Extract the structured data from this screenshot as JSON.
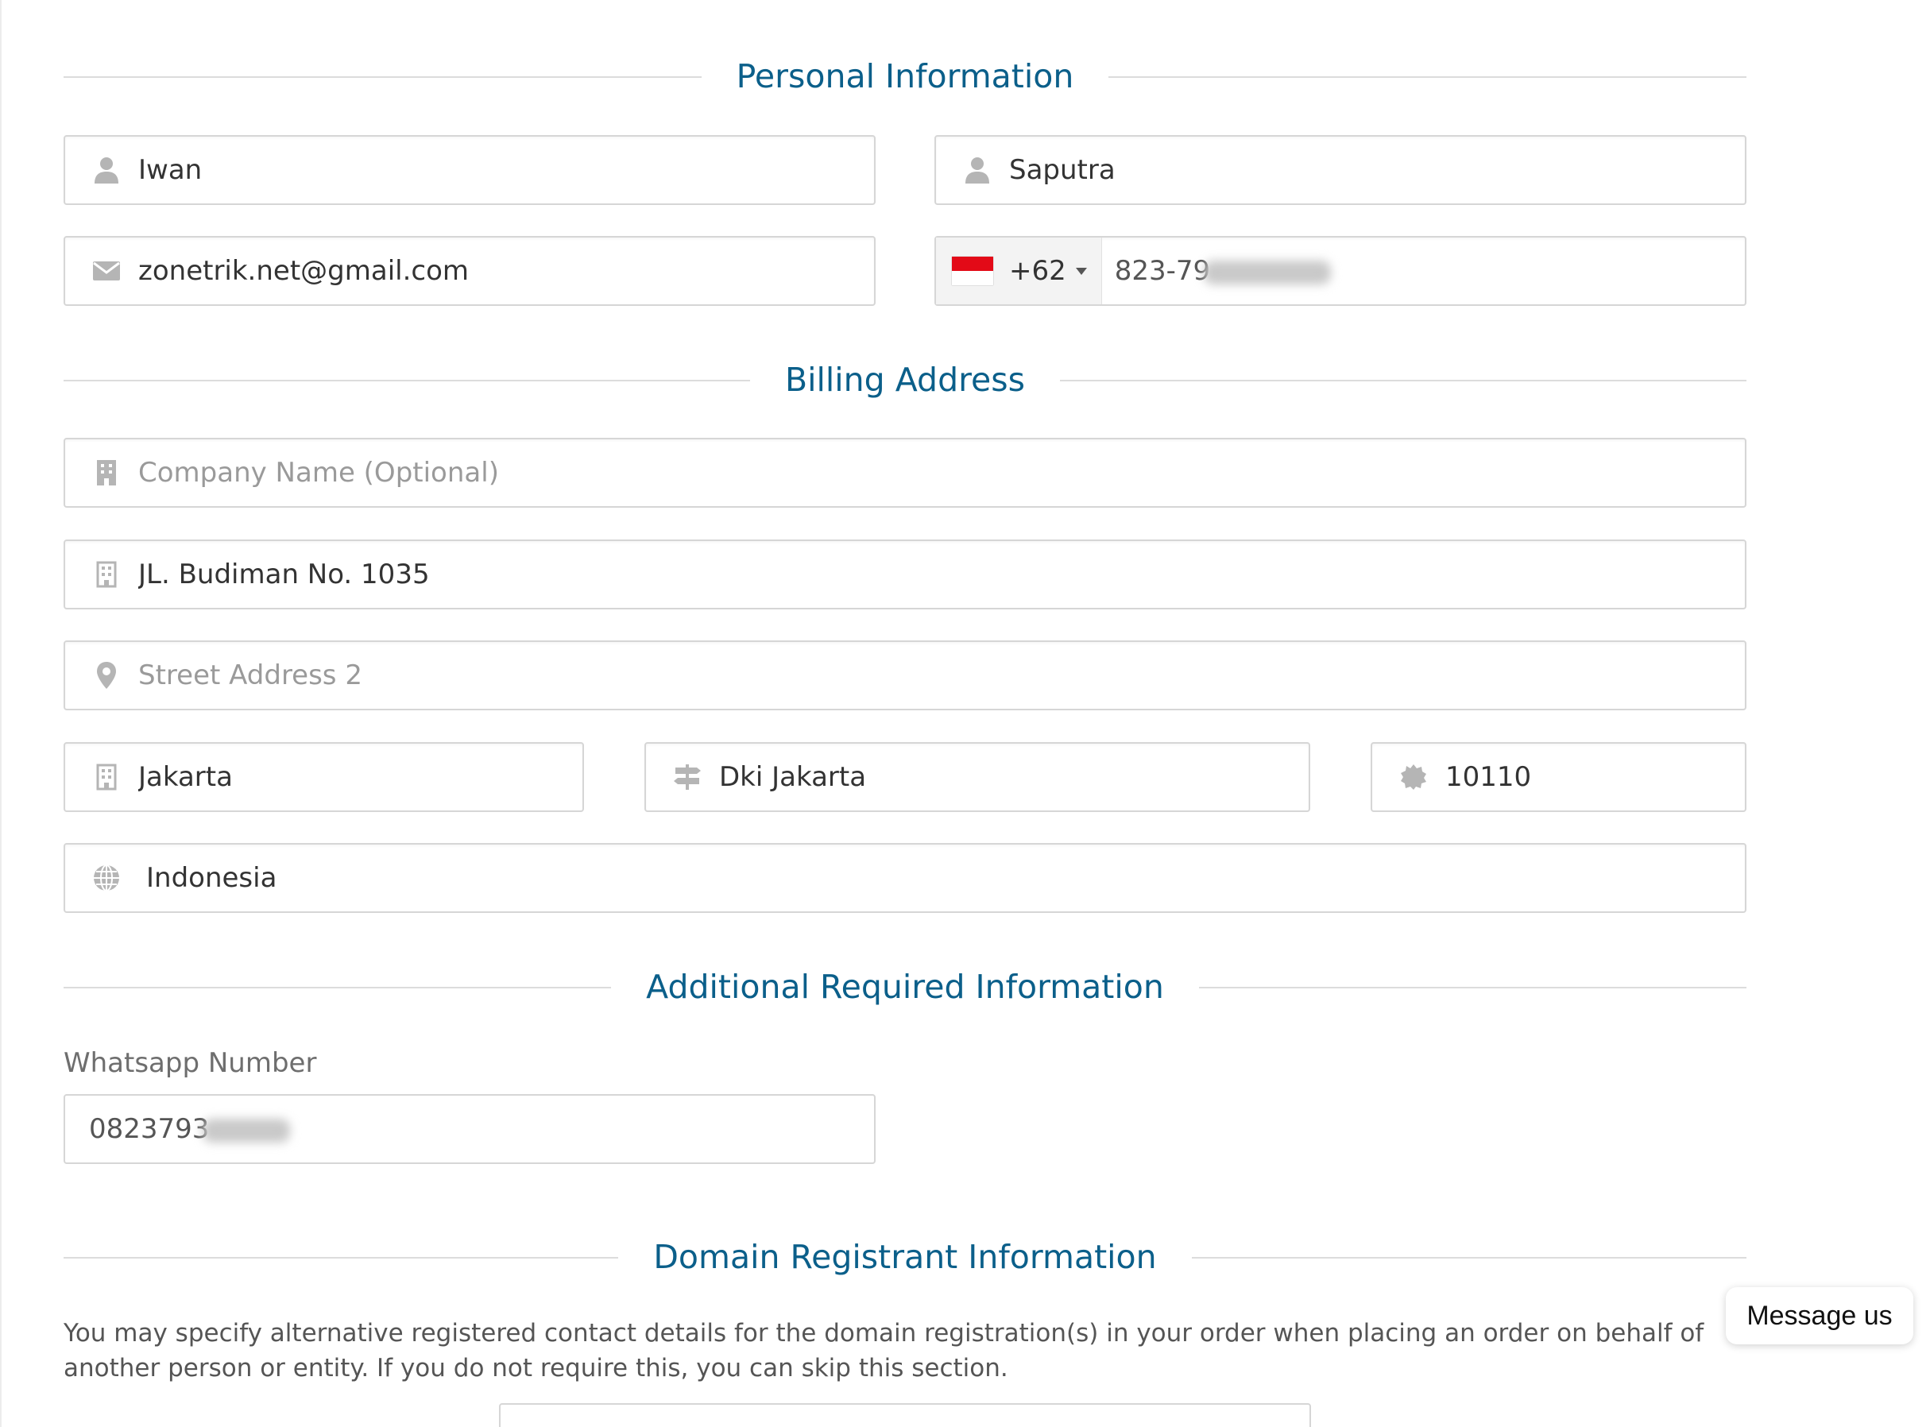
{
  "sections": {
    "personal": "Personal Information",
    "billing": "Billing Address",
    "additional": "Additional Required Information",
    "domain": "Domain Registrant Information"
  },
  "personal": {
    "first_name": "Iwan",
    "last_name": "Saputra",
    "email": "zonetrik.net@gmail.com",
    "phone_dial_code": "+62",
    "phone_number_visible": "823-79"
  },
  "billing": {
    "company_placeholder": "Company Name (Optional)",
    "address1": "JL. Budiman No. 1035",
    "address2_placeholder": "Street Address 2",
    "city": "Jakarta",
    "state": "Dki Jakarta",
    "postcode": "10110",
    "country": "Indonesia"
  },
  "additional": {
    "whatsapp_label": "Whatsapp Number",
    "whatsapp_visible": "0823793"
  },
  "domain": {
    "description": "You may specify alternative registered contact details for the domain registration(s) in your order when placing an order on behalf of another person or entity. If you do not require this, you can skip this section."
  },
  "chat": {
    "label": "Message us"
  },
  "colors": {
    "heading": "#0b5f8a",
    "icon": "#b5b5b5",
    "flag_red": "#e30a17"
  },
  "icons": [
    "user-icon",
    "envelope-icon",
    "building-icon",
    "map-marker-icon",
    "signs-icon",
    "certificate-icon",
    "globe-icon"
  ]
}
